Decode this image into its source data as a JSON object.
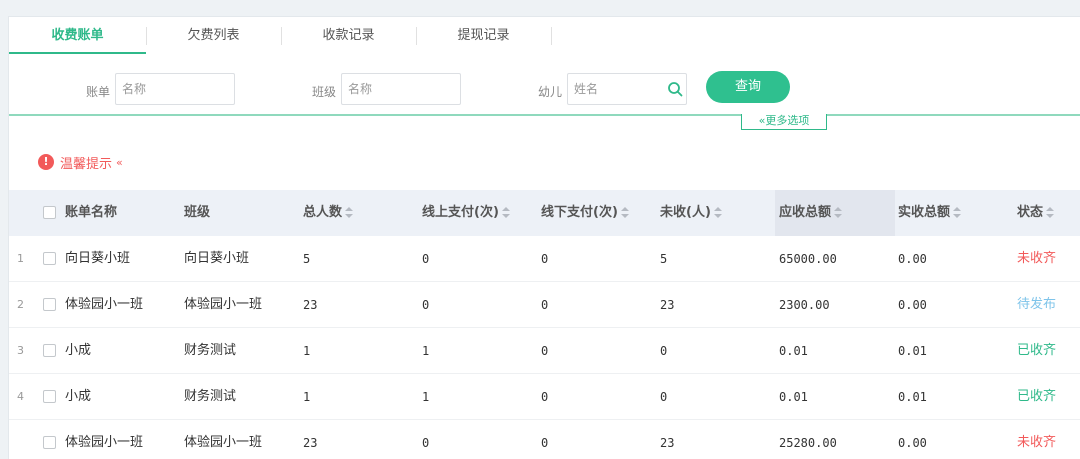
{
  "tabs": [
    "收费账单",
    "欠费列表",
    "收款记录",
    "提现记录"
  ],
  "filters": {
    "bill_label": "账单",
    "bill_placeholder": "名称",
    "class_label": "班级",
    "class_placeholder": "名称",
    "child_label": "幼儿",
    "child_placeholder": "姓名",
    "query_label": "查询",
    "more_label": "更多选项"
  },
  "tip": {
    "label": "温馨提示"
  },
  "table": {
    "columns": [
      "账单名称",
      "班级",
      "总人数",
      "线上支付(次)",
      "线下支付(次)",
      "未收(人)",
      "应收总额",
      "实收总额",
      "状态"
    ],
    "rows": [
      {
        "no": "1",
        "name": "向日葵小班",
        "class": "向日葵小班",
        "total": "5",
        "online": "0",
        "offline": "0",
        "unpaid": "5",
        "due": "65000.00",
        "received": "0.00",
        "status": "未收齐",
        "status_color": "#f25a5a"
      },
      {
        "no": "2",
        "name": "体验园小一班",
        "class": "体验园小一班",
        "total": "23",
        "online": "0",
        "offline": "0",
        "unpaid": "23",
        "due": "2300.00",
        "received": "0.00",
        "status": "待发布",
        "status_color": "#7ec4ea"
      },
      {
        "no": "3",
        "name": "小成",
        "class": "财务测试",
        "total": "1",
        "online": "1",
        "offline": "0",
        "unpaid": "0",
        "due": "0.01",
        "received": "0.01",
        "status": "已收齐",
        "status_color": "#2fb98a"
      },
      {
        "no": "4",
        "name": "小成",
        "class": "财务测试",
        "total": "1",
        "online": "1",
        "offline": "0",
        "unpaid": "0",
        "due": "0.01",
        "received": "0.01",
        "status": "已收齐",
        "status_color": "#2fb98a"
      },
      {
        "no": "",
        "name": "体验园小一班",
        "class": "体验园小一班",
        "total": "23",
        "online": "0",
        "offline": "0",
        "unpaid": "23",
        "due": "25280.00",
        "received": "0.00",
        "status": "未收齐",
        "status_color": "#f25a5a"
      }
    ]
  },
  "colors": {
    "accent": "#2fc08f",
    "alert": "#f25a5a",
    "pending": "#7ec4ea"
  }
}
